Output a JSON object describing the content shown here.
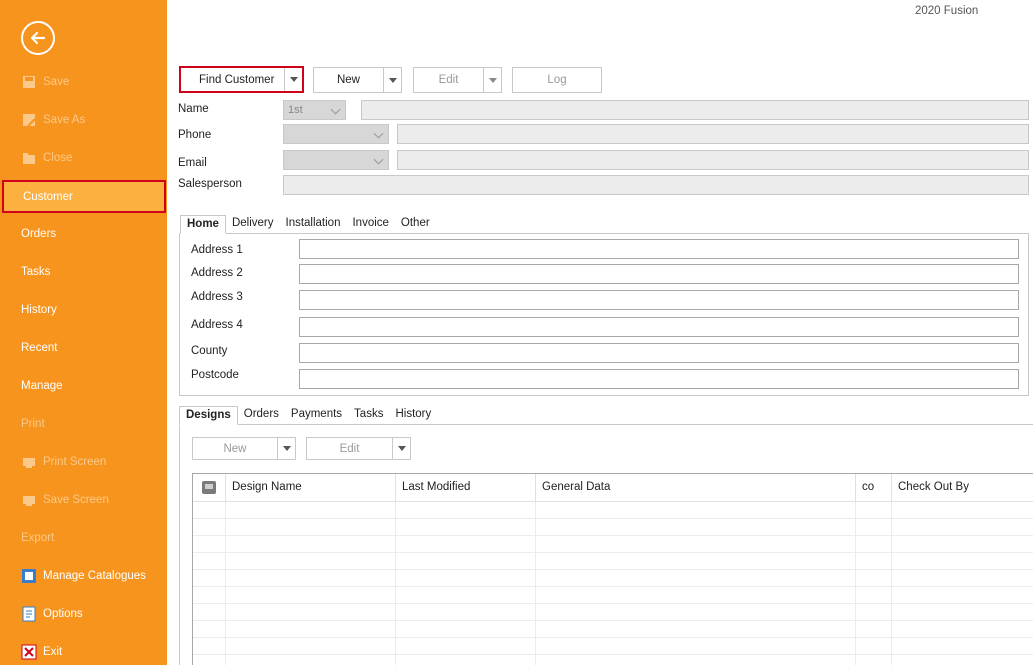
{
  "app": {
    "title": "2020 Fusion"
  },
  "sidebar": {
    "items": [
      {
        "label": "Save",
        "enabled": false,
        "icon": "save-icon"
      },
      {
        "label": "Save As",
        "enabled": false,
        "icon": "save-as-icon"
      },
      {
        "label": "Close",
        "enabled": false,
        "icon": "folder-close-icon"
      },
      {
        "label": "Customer",
        "enabled": true,
        "selected": true
      },
      {
        "label": "Orders",
        "enabled": true
      },
      {
        "label": "Tasks",
        "enabled": true
      },
      {
        "label": "History",
        "enabled": true
      },
      {
        "label": "Recent",
        "enabled": true
      },
      {
        "label": "Manage",
        "enabled": true
      },
      {
        "label": "Print",
        "enabled": false
      },
      {
        "label": "Print Screen",
        "enabled": false,
        "icon": "print-screen-icon"
      },
      {
        "label": "Save Screen",
        "enabled": false,
        "icon": "save-screen-icon"
      },
      {
        "label": "Export",
        "enabled": false
      },
      {
        "label": "Manage Catalogues",
        "enabled": true,
        "icon": "catalogue-icon"
      },
      {
        "label": "Options",
        "enabled": true,
        "icon": "options-icon"
      },
      {
        "label": "Exit",
        "enabled": true,
        "icon": "exit-icon"
      }
    ]
  },
  "toolbar": {
    "find_customer": "Find Customer",
    "new": "New",
    "edit": "Edit",
    "log": "Log"
  },
  "form": {
    "name_label": "Name",
    "name_select": "1st",
    "phone_label": "Phone",
    "email_label": "Email",
    "salesperson_label": "Salesperson"
  },
  "address_tabs": [
    "Home",
    "Delivery",
    "Installation",
    "Invoice",
    "Other"
  ],
  "address_fields": [
    "Address 1",
    "Address 2",
    "Address 3",
    "Address 4",
    "County",
    "Postcode"
  ],
  "design_tabs": [
    "Designs",
    "Orders",
    "Payments",
    "Tasks",
    "History"
  ],
  "designs_toolbar": {
    "new": "New",
    "edit": "Edit"
  },
  "grid": {
    "columns": [
      "Design Name",
      "Last Modified",
      "General Data",
      "co",
      "Check Out By"
    ]
  },
  "colors": {
    "sidebar": "#f7941d",
    "highlight": "#d0021b"
  }
}
